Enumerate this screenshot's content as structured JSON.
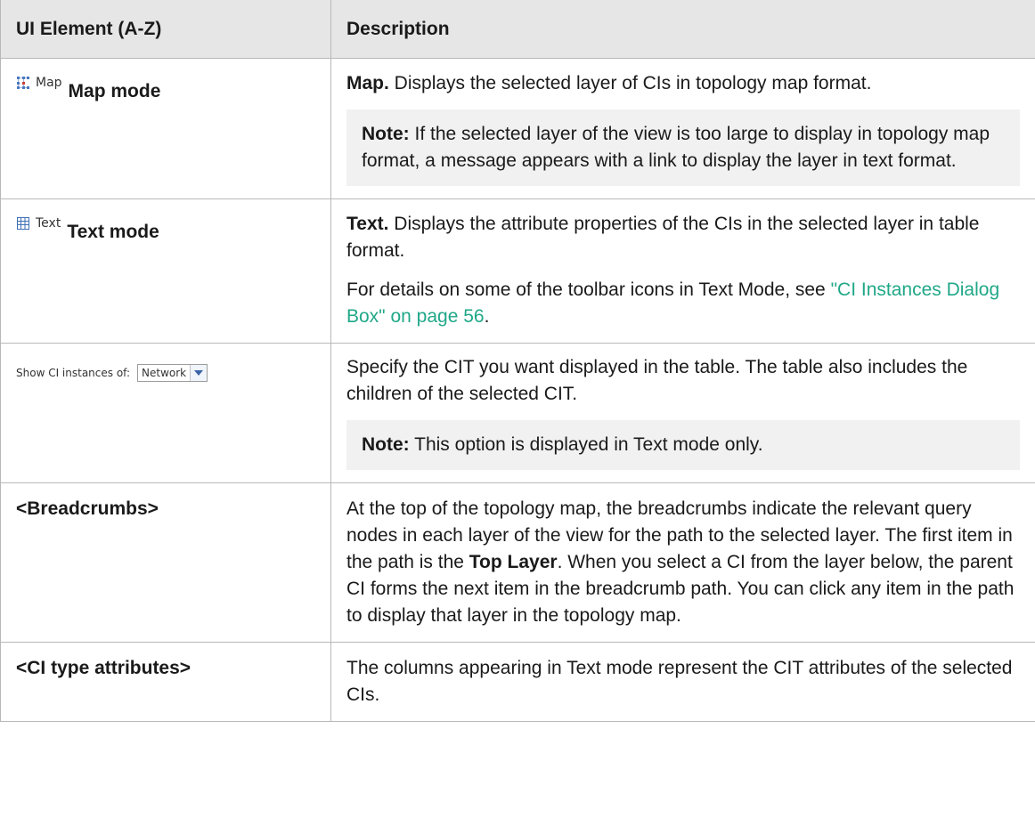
{
  "header": {
    "col1": "UI Element (A-Z)",
    "col2": "Description"
  },
  "rows": {
    "map": {
      "button_label": "Map",
      "button_icon": "map-mode-icon",
      "title": "Map mode",
      "desc_lead": "Map.",
      "desc_text": " Displays the selected layer of CIs in topology map format.",
      "note_lead": "Note:",
      "note_text": " If the selected layer of the view is too large to display in topology map format, a message appears with a link to display the layer in text format."
    },
    "text": {
      "button_label": "Text",
      "button_icon": "table-grid-icon",
      "title": "Text mode",
      "desc_lead": "Text.",
      "desc_text": " Displays the attribute properties of the CIs in the selected layer in table format.",
      "para2_pre": "For details on some of the toolbar icons in Text Mode, see ",
      "para2_link": "\"CI Instances Dialog Box\" on page 56",
      "para2_post": "."
    },
    "show": {
      "label": "Show CI instances of:",
      "combo_value": "Network",
      "desc": "Specify the CIT you want displayed in the table. The table also includes the children of the selected CIT.",
      "note_lead": "Note:",
      "note_text": " This option is displayed in Text mode only."
    },
    "breadcrumbs": {
      "title": "<Breadcrumbs>",
      "desc_pre": "At the top of the topology map, the breadcrumbs indicate the relevant query nodes in each layer of the view for the path to the selected layer. The first item in the path is the ",
      "desc_bold": "Top Layer",
      "desc_post": ". When you select a CI from the layer below, the parent CI forms the next item in the breadcrumb path. You can click any item in the path to display that layer in the topology map."
    },
    "ci_type": {
      "title": "<CI type attributes>",
      "desc": "The columns appearing in Text mode represent the CIT attributes of the selected CIs."
    }
  },
  "colors": {
    "header_bg": "#e6e6e6",
    "note_bg": "#f1f1f1",
    "link": "#20a888",
    "border": "#b8b8b8"
  }
}
